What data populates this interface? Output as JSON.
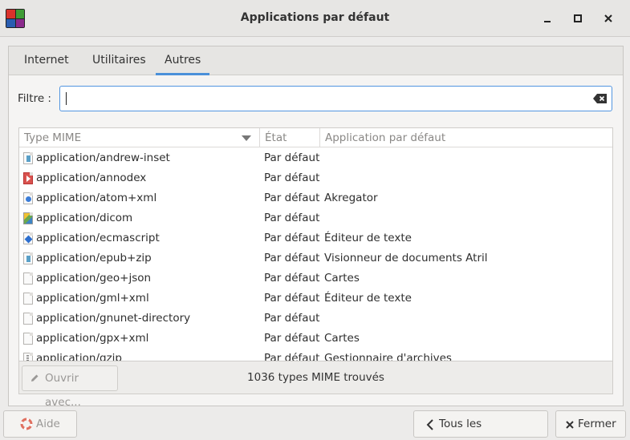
{
  "window": {
    "title": "Applications par défaut",
    "app_icon_colors": [
      "#d9322b",
      "#3f9c35",
      "#2a5db0",
      "#8b2a8c"
    ]
  },
  "tabs": [
    {
      "label": "Internet",
      "active": false
    },
    {
      "label": "Utilitaires",
      "active": false
    },
    {
      "label": "Autres",
      "active": true
    }
  ],
  "filter": {
    "label": "Filtre :",
    "value": "",
    "placeholder": ""
  },
  "table": {
    "columns": [
      "Type MIME",
      "État",
      "Application par défaut"
    ],
    "rows": [
      {
        "mime": "application/andrew-inset",
        "state": "Par défaut",
        "app": "",
        "icon": "book-file-icon"
      },
      {
        "mime": "application/annodex",
        "state": "Par défaut",
        "app": "",
        "icon": "video-file-icon"
      },
      {
        "mime": "application/atom+xml",
        "state": "Par défaut",
        "app": "Akregator",
        "icon": "web-file-icon"
      },
      {
        "mime": "application/dicom",
        "state": "Par défaut",
        "app": "",
        "icon": "image-file-icon"
      },
      {
        "mime": "application/ecmascript",
        "state": "Par défaut",
        "app": "Éditeur de texte",
        "icon": "script-file-icon"
      },
      {
        "mime": "application/epub+zip",
        "state": "Par défaut",
        "app": "Visionneur de documents Atril",
        "icon": "book-file-icon"
      },
      {
        "mime": "application/geo+json",
        "state": "Par défaut",
        "app": "Cartes",
        "icon": "file-icon"
      },
      {
        "mime": "application/gml+xml",
        "state": "Par défaut",
        "app": "Éditeur de texte",
        "icon": "file-icon"
      },
      {
        "mime": "application/gnunet-directory",
        "state": "Par défaut",
        "app": "",
        "icon": "file-icon"
      },
      {
        "mime": "application/gpx+xml",
        "state": "Par défaut",
        "app": "Cartes",
        "icon": "file-icon"
      },
      {
        "mime": "application/gzip",
        "state": "Par défaut",
        "app": "Gestionnaire d'archives",
        "icon": "archive-file-icon"
      }
    ]
  },
  "bottom": {
    "open_with_label": "Ouvrir avec...",
    "found_label": "1036 types MIME trouvés"
  },
  "footer": {
    "help_label": "Aide",
    "back_label": "Tous les paramètres",
    "close_label": "Fermer"
  }
}
